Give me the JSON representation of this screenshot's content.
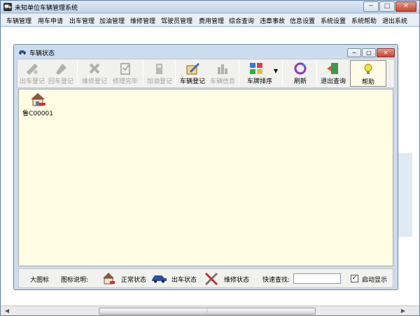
{
  "window": {
    "title": "未知单位车辆管理系统",
    "controls": {
      "min": "─",
      "max": "□",
      "close": "✕"
    }
  },
  "menu": [
    "车辆管理",
    "用车申请",
    "出车管理",
    "加油管理",
    "维修管理",
    "驾驶员管理",
    "费用管理",
    "综合查询",
    "违章事故",
    "信息设置",
    "系统设置",
    "系统帮助",
    "退出系统"
  ],
  "child": {
    "title": "车辆状态",
    "controls": {
      "min": "─",
      "max": "□",
      "close": "✕"
    }
  },
  "toolbar": [
    {
      "label": "出车登记",
      "icon": "car-out-icon",
      "enabled": false
    },
    {
      "label": "回车登记",
      "icon": "car-return-icon",
      "enabled": false
    },
    {
      "label": "维修登记",
      "icon": "repair-register-icon",
      "enabled": false
    },
    {
      "label": "修理完毕",
      "icon": "repair-done-icon",
      "enabled": false
    },
    {
      "label": "加油登记",
      "icon": "fuel-icon",
      "enabled": false
    },
    {
      "label": "车辆登记",
      "icon": "vehicle-register-icon",
      "enabled": true
    },
    {
      "label": "车辆信息",
      "icon": "vehicle-info-icon",
      "enabled": false
    },
    {
      "label": "车牌排序",
      "icon": "plate-sort-icon",
      "enabled": true
    },
    {
      "label": "刷新",
      "icon": "refresh-icon",
      "enabled": true
    },
    {
      "label": "退出查询",
      "icon": "exit-query-icon",
      "enabled": true
    },
    {
      "label": "帮助",
      "icon": "help-icon",
      "enabled": true
    }
  ],
  "vehicles": [
    {
      "plate": "鲁C00001",
      "icon": "house-car-icon"
    }
  ],
  "status": {
    "view_mode": "大图标",
    "legend_label": "图标说明:",
    "normal": "正常状态",
    "out": "出车状态",
    "repair": "维修状态",
    "search_label": "快速查找:",
    "search_value": "",
    "autoshow_label": "启动显示",
    "autoshow_checked": true
  },
  "hscroll": {
    "left": "◀",
    "right": "▶",
    "grip": "⦙"
  },
  "colors": {
    "content_bg": "#fffde4",
    "toolbar_bg": "#f1f1ee",
    "window_frame": "#cbdcee"
  }
}
